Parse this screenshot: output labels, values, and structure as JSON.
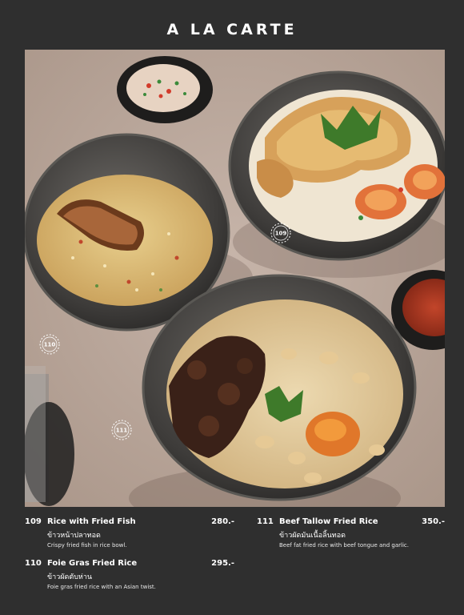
{
  "header": {
    "title": "A LA CARTE"
  },
  "photo": {
    "badges": [
      {
        "id": "109",
        "label": "109"
      },
      {
        "id": "110",
        "label": "110"
      },
      {
        "id": "111",
        "label": "111"
      }
    ]
  },
  "menu": [
    {
      "number": "109",
      "name": "Rice with Fried Fish",
      "price": "280.-",
      "thai": "ข้าวหน้าปลาทอด",
      "description": "Crispy fried fish in rice bowl."
    },
    {
      "number": "110",
      "name": "Foie Gras Fried Rice",
      "price": "295.-",
      "thai": "ข้าวผัดตับห่าน",
      "description": "Foie gras fried rice with an Asian twist."
    },
    {
      "number": "111",
      "name": "Beef Tallow Fried Rice",
      "price": "350.-",
      "thai": "ข้าวผัดมันเนื้อลิ้นทอด",
      "description": "Beef fat fried rice with beef tongue and garlic."
    }
  ]
}
